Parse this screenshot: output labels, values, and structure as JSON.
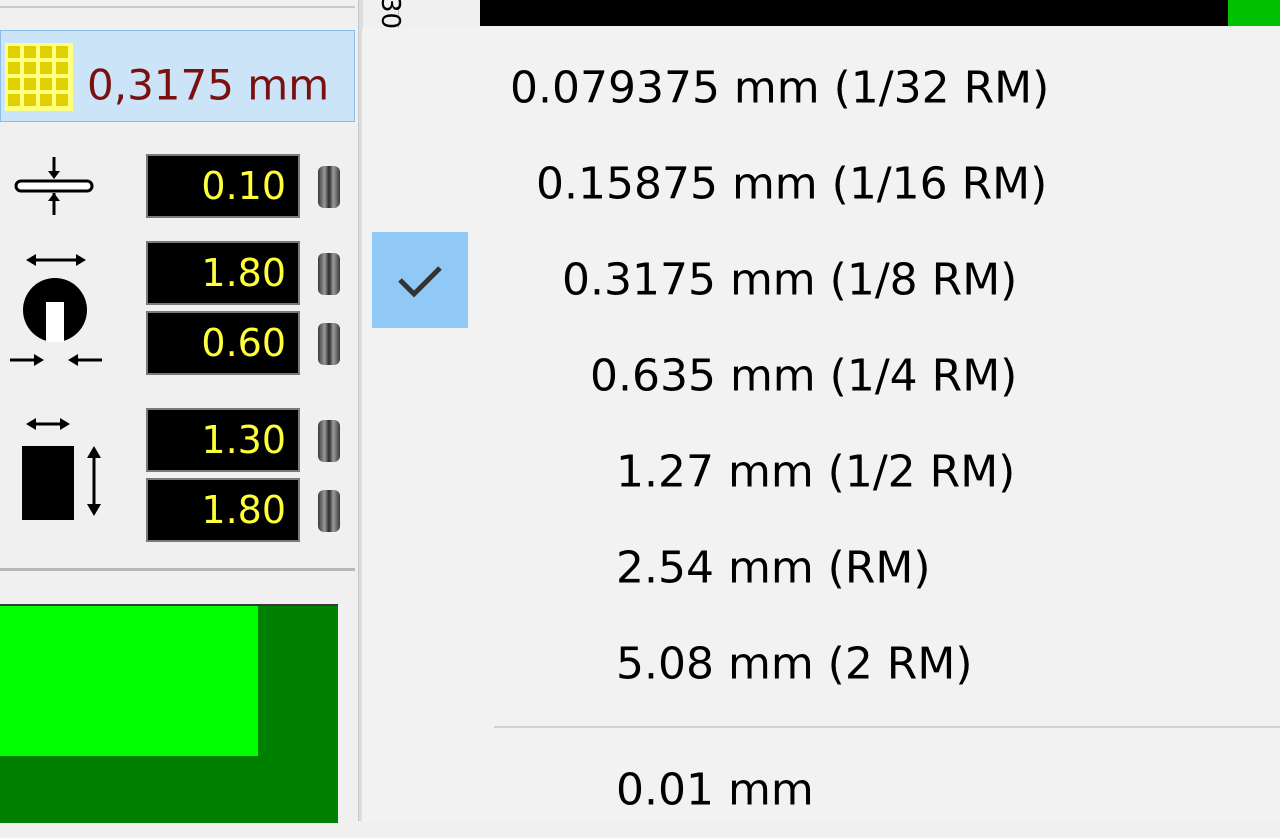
{
  "grid_selector": {
    "value": "0,3175 mm",
    "icon": "grid-icon"
  },
  "parameters": {
    "line_width": {
      "value": "0.10",
      "icon": "line-width-icon"
    },
    "pad_outer": {
      "value": "1.80",
      "icon": "pad-diameter-icon"
    },
    "pad_drill": {
      "value": "0.60"
    },
    "smd_width": {
      "value": "1.30",
      "icon": "smd-pad-icon"
    },
    "smd_height": {
      "value": "1.80"
    }
  },
  "top_bar": {
    "label": "30"
  },
  "menu": {
    "items": [
      {
        "label": "0.079375 mm (1/32 RM)",
        "checked": false
      },
      {
        "label": "0.15875 mm (1/16 RM)",
        "checked": false
      },
      {
        "label": "0.3175 mm (1/8 RM)",
        "checked": true
      },
      {
        "label": "0.635 mm (1/4 RM)",
        "checked": false
      },
      {
        "label": "1.27 mm (1/2 RM)",
        "checked": false
      },
      {
        "label": "2.54 mm (RM)",
        "checked": false
      },
      {
        "label": "5.08 mm (2 RM)",
        "checked": false
      }
    ],
    "extra_items": [
      {
        "label": "0.01 mm"
      }
    ]
  },
  "colors": {
    "value_text": "#ffff3a",
    "grid_text": "#7a1010",
    "selection": "#90c8f6",
    "pcb_green": "#00ff00",
    "pcb_dark_green": "#008000"
  }
}
